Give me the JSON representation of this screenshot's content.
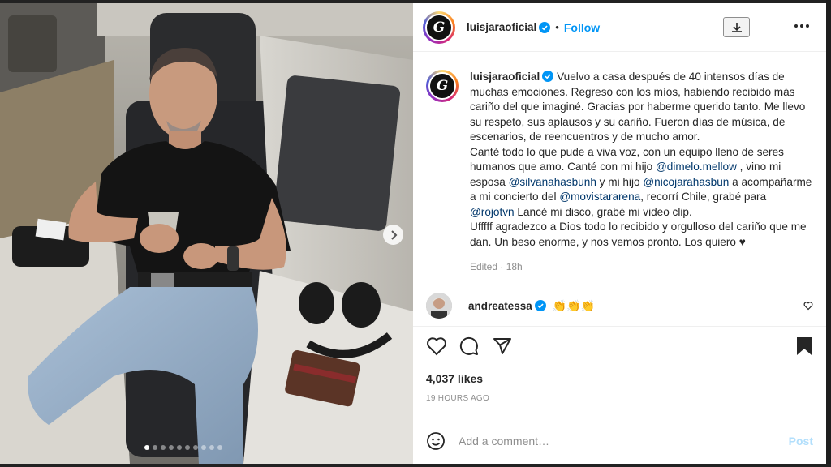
{
  "post": {
    "username": "luisjaraoficial",
    "avatar_letter": "G",
    "follow_label": "Follow",
    "separator": "•",
    "caption_before_1": "Vuelvo a casa después de 40 intensos días de muchas emociones. Regreso con los míos, habiendo recibido más cariño del que imaginé. Gracias por haberme querido tanto. Me llevo su respeto, sus aplausos y su cariño. Fueron días de música, de escenarios, de reencuentros y de mucho amor.\nCanté todo lo que pude a viva voz, con un equipo lleno de seres humanos que amo. Canté con mi hijo ",
    "mention_1": "@dimelo.mellow",
    "caption_2": " , vino mi esposa ",
    "mention_2": "@silvanahasbunh",
    "caption_3": " y mi hijo ",
    "mention_3": "@nicojarahasbun",
    "caption_4": " a acompañarme a mi concierto del ",
    "mention_4": "@movistararena",
    "caption_5": ", recorrí Chile, grabé para ",
    "mention_5": "@rojotvn",
    "caption_6": " Lancé mi disco, grabé mi video clip.\nUfffff agradezco a Dios todo lo recibido y orgulloso del cariño que me dan. Un beso enorme, y nos vemos pronto. Los quiero ♥",
    "edited": "Edited · 18h"
  },
  "comment": {
    "username": "andreatessa",
    "text": "👏👏👏"
  },
  "stats": {
    "likes": "4,037 likes",
    "time_ago": "19 HOURS AGO"
  },
  "composer": {
    "placeholder": "Add a comment…",
    "post_label": "Post"
  },
  "carousel": {
    "slide_count": 10,
    "active_index": 0
  },
  "icons": {
    "verified": "verified-badge-icon",
    "download": "download-icon",
    "more": "more-options-icon",
    "like": "heart-icon",
    "comment": "comment-icon",
    "share": "share-icon",
    "save": "bookmark-icon",
    "emoji": "emoji-icon",
    "next": "chevron-right-icon"
  },
  "colors": {
    "accent": "#0095f6",
    "mention": "#00376b",
    "muted": "#8e8e8e",
    "post_disabled": "#b2dffc"
  }
}
